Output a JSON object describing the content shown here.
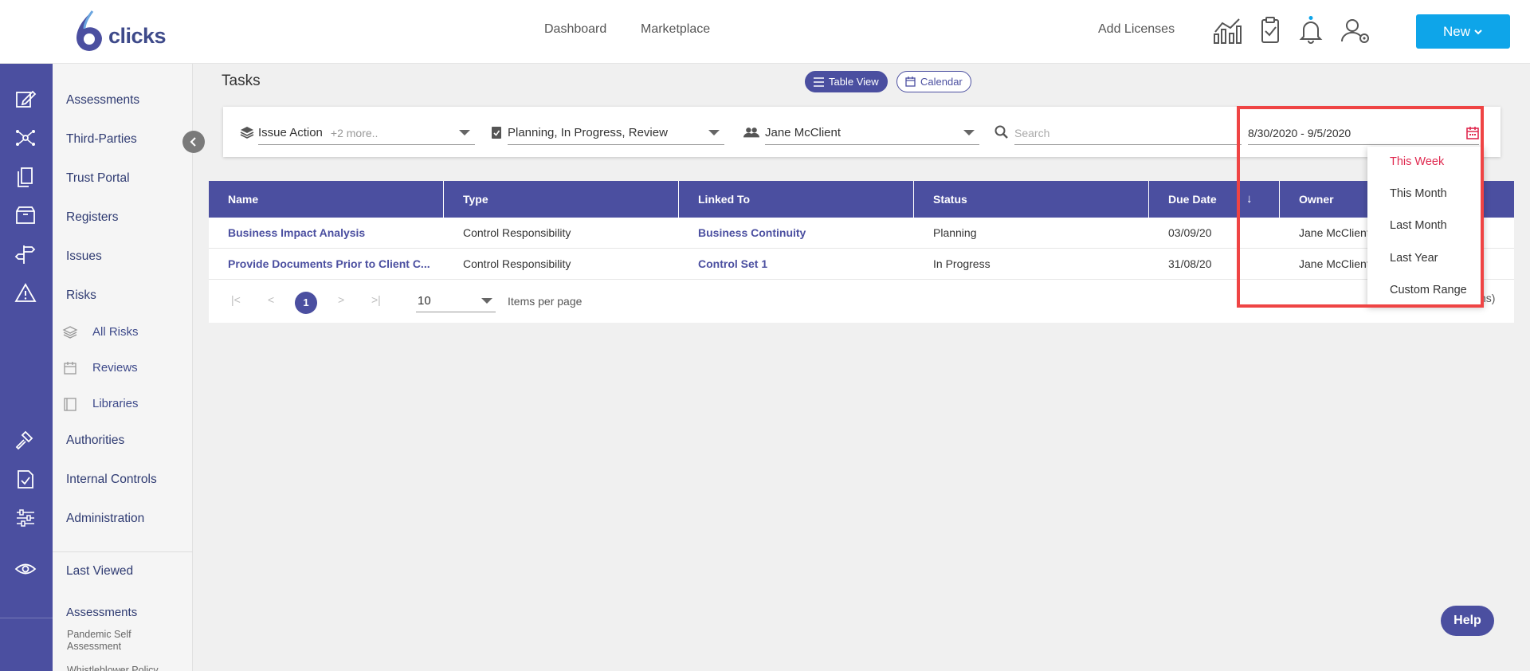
{
  "header": {
    "logo_text": "clicks",
    "nav": [
      "Dashboard",
      "Marketplace"
    ],
    "add_licenses": "Add Licenses",
    "new_button": "New",
    "icons": [
      "analytics-chart-icon",
      "clipboard-check-icon",
      "bell-icon",
      "user-settings-icon"
    ],
    "notification_dot_color": "#0ea5e9"
  },
  "rail_icons": [
    "edit-icon",
    "network-icon",
    "documents-icon",
    "box-icon",
    "signpost-icon",
    "warning-icon",
    "gavel-icon",
    "checklist-icon",
    "sliders-icon",
    "eye-icon"
  ],
  "sidebar": {
    "items": [
      "Assessments",
      "Third-Parties",
      "Trust Portal",
      "Registers",
      "Issues",
      "Risks"
    ],
    "risk_subitems": [
      "All Risks",
      "Reviews",
      "Libraries"
    ],
    "items_lower": [
      "Authorities",
      "Internal Controls",
      "Administration"
    ],
    "last_viewed": "Last Viewed",
    "recent_heading": "Assessments",
    "recent_items": [
      "Pandemic Self Assessment",
      "Whistleblower Policy"
    ]
  },
  "main": {
    "title": "Tasks",
    "views": [
      "Table View",
      "Calendar"
    ]
  },
  "filters": {
    "type_value": "Issue Action",
    "type_more": "+2 more..",
    "status_value": "Planning, In Progress, Review",
    "owner_value": "Jane McClient",
    "search_placeholder": "Search",
    "date_range": "8/30/2020 - 9/5/2020"
  },
  "table": {
    "columns": [
      "Name",
      "Type",
      "Linked To",
      "Status",
      "Due Date",
      "Owner"
    ],
    "sort_indicator": "↓",
    "rows": [
      {
        "name": "Business Impact Analysis",
        "type": "Control Responsibility",
        "linked": "Business Continuity",
        "status": "Planning",
        "due": "03/09/20",
        "owner": "Jane McClient"
      },
      {
        "name": "Provide Documents Prior to Client C...",
        "type": "Control Responsibility",
        "linked": "Control Set 1",
        "status": "In Progress",
        "due": "31/08/20",
        "owner": "Jane McClient"
      }
    ]
  },
  "pagination": {
    "first": "|<",
    "prev": "<",
    "current": "1",
    "next": ">",
    "last": ">|",
    "per_page": "10",
    "per_page_label": "Items per page",
    "summary_fragment": "ns)"
  },
  "date_dropdown": {
    "options": [
      "This Week",
      "This Month",
      "Last Month",
      "Last Year",
      "Custom Range"
    ],
    "active_color": "#e0294f"
  },
  "help_button": "Help",
  "colors": {
    "primary": "#4b4fa0",
    "accent": "#0ea5e9",
    "highlight": "#ef4444"
  }
}
